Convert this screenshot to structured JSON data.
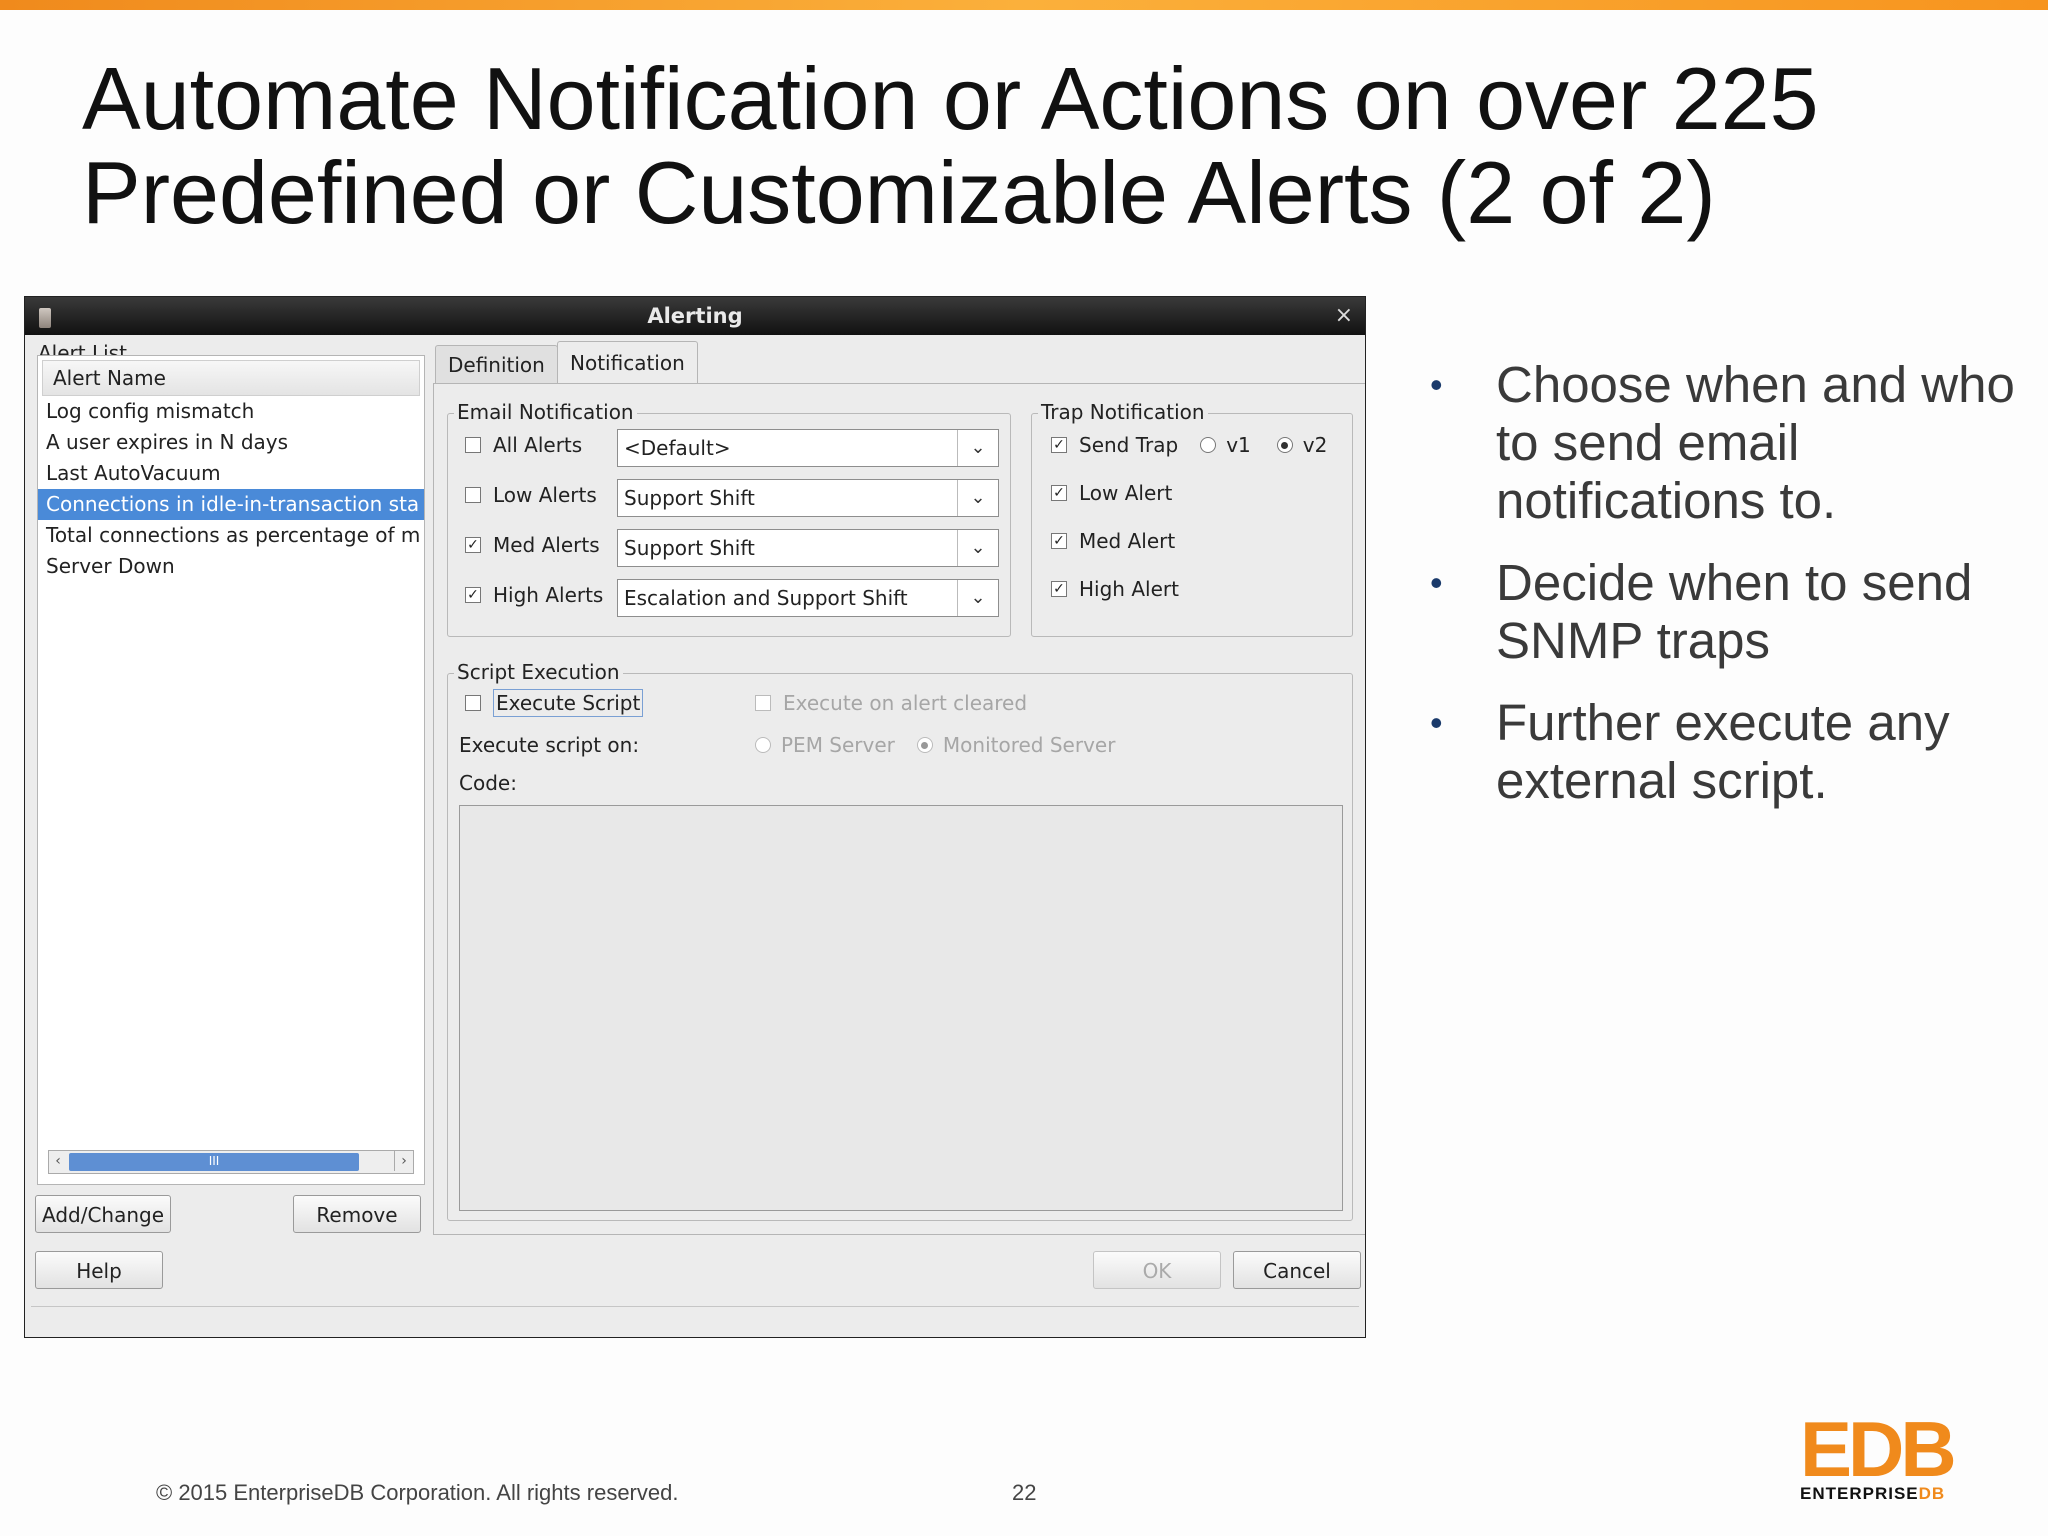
{
  "slide": {
    "title_line1": "Automate Notification or Actions on over 225",
    "title_line2": "Predefined or Customizable Alerts (2 of 2)",
    "bullets": [
      "Choose when and who to send email notifications to.",
      "Decide when to send SNMP traps",
      "Further execute any external script."
    ],
    "footer_copyright": "© 2015 EnterpriseDB Corporation. All rights reserved.",
    "page_number": "22",
    "logo_mark": "EDB",
    "logo_word_a": "ENTERPRISE",
    "logo_word_b": "DB",
    "accent_color": "#f08a1c"
  },
  "dialog": {
    "title": "Alerting",
    "close_glyph": "×",
    "alert_list": {
      "legend": "Alert List",
      "column_header": "Alert Name",
      "items": [
        "Log config mismatch",
        "A user expires in N days",
        "Last AutoVacuum",
        "Connections in idle-in-transaction sta",
        "Total connections as percentage of m",
        "Server Down"
      ],
      "selected_index": 3,
      "scroll_thumb": "III"
    },
    "buttons": {
      "add_change": "Add/Change",
      "remove": "Remove",
      "help": "Help",
      "ok": "OK",
      "cancel": "Cancel"
    },
    "tabs": [
      "Definition",
      "Notification"
    ],
    "active_tab": "Notification",
    "email": {
      "legend": "Email Notification",
      "rows": [
        {
          "label": "All Alerts",
          "checked": false,
          "group": "<Default>"
        },
        {
          "label": "Low Alerts",
          "checked": false,
          "group": "Support Shift"
        },
        {
          "label": "Med Alerts",
          "checked": true,
          "group": "Support Shift"
        },
        {
          "label": "High Alerts",
          "checked": true,
          "group": "Escalation and Support Shift"
        }
      ]
    },
    "trap": {
      "legend": "Trap Notification",
      "send_trap": "Send Trap",
      "send_trap_checked": true,
      "v1": "v1",
      "v2": "v2",
      "version_selected": "v2",
      "low": "Low Alert",
      "med": "Med Alert",
      "high": "High Alert"
    },
    "script": {
      "legend": "Script Execution",
      "execute_script": "Execute Script",
      "execute_on_cleared": "Execute on alert cleared",
      "execute_on_label": "Execute script on:",
      "pem_server": "PEM Server",
      "monitored_server": "Monitored Server",
      "selected_target": "Monitored Server",
      "code_label": "Code:",
      "code": ""
    }
  }
}
